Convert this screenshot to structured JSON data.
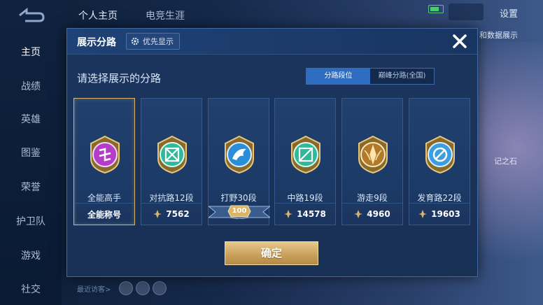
{
  "sidebar": {
    "items": [
      {
        "label": "主页",
        "active": true
      },
      {
        "label": "战绩",
        "active": false
      },
      {
        "label": "英雄",
        "active": false
      },
      {
        "label": "图鉴",
        "active": false
      },
      {
        "label": "荣誉",
        "active": false
      },
      {
        "label": "护卫队",
        "active": false
      },
      {
        "label": "游戏",
        "active": false
      },
      {
        "label": "社交",
        "active": false
      }
    ]
  },
  "topbar": {
    "tabs": [
      {
        "label": "个人主页",
        "active": true
      },
      {
        "label": "电竞生涯",
        "active": false
      }
    ],
    "settings_label": "设置"
  },
  "background": {
    "right_text_1": "和数据展示",
    "right_text_2": "记之石",
    "visitor_label": "最近访客>"
  },
  "dialog": {
    "title": "展示分路",
    "priority_label": "优先显示",
    "subtitle": "请选择展示的分路",
    "toggle": {
      "options": [
        "分路段位",
        "巅峰分路(全国)"
      ],
      "selected": "分路段位"
    },
    "cards": [
      {
        "name": "全能高手",
        "footer": "全能称号",
        "selected": true,
        "badge_color": "#b43cc8",
        "badge_icon": "allround-icon"
      },
      {
        "name": "对抗路12段",
        "footer": "7562",
        "selected": false,
        "badge_color": "#2fb89a",
        "badge_icon": "clash-lane-icon"
      },
      {
        "name": "打野30段",
        "footer": "",
        "ribbon": "100",
        "selected": false,
        "badge_color": "#2a8fd8",
        "badge_icon": "jungle-icon"
      },
      {
        "name": "中路19段",
        "footer": "14578",
        "selected": false,
        "badge_color": "#2fb89a",
        "badge_icon": "mid-lane-icon"
      },
      {
        "name": "游走9段",
        "footer": "4960",
        "selected": false,
        "badge_color": "#b07a2a",
        "badge_icon": "roam-icon"
      },
      {
        "name": "发育路22段",
        "footer": "19603",
        "selected": false,
        "badge_color": "#3a9ee0",
        "badge_icon": "farm-lane-icon"
      }
    ],
    "confirm_label": "确定"
  },
  "colors": {
    "accent_gold": "#d9b46a",
    "toggle_active": "#2d6cbf"
  }
}
